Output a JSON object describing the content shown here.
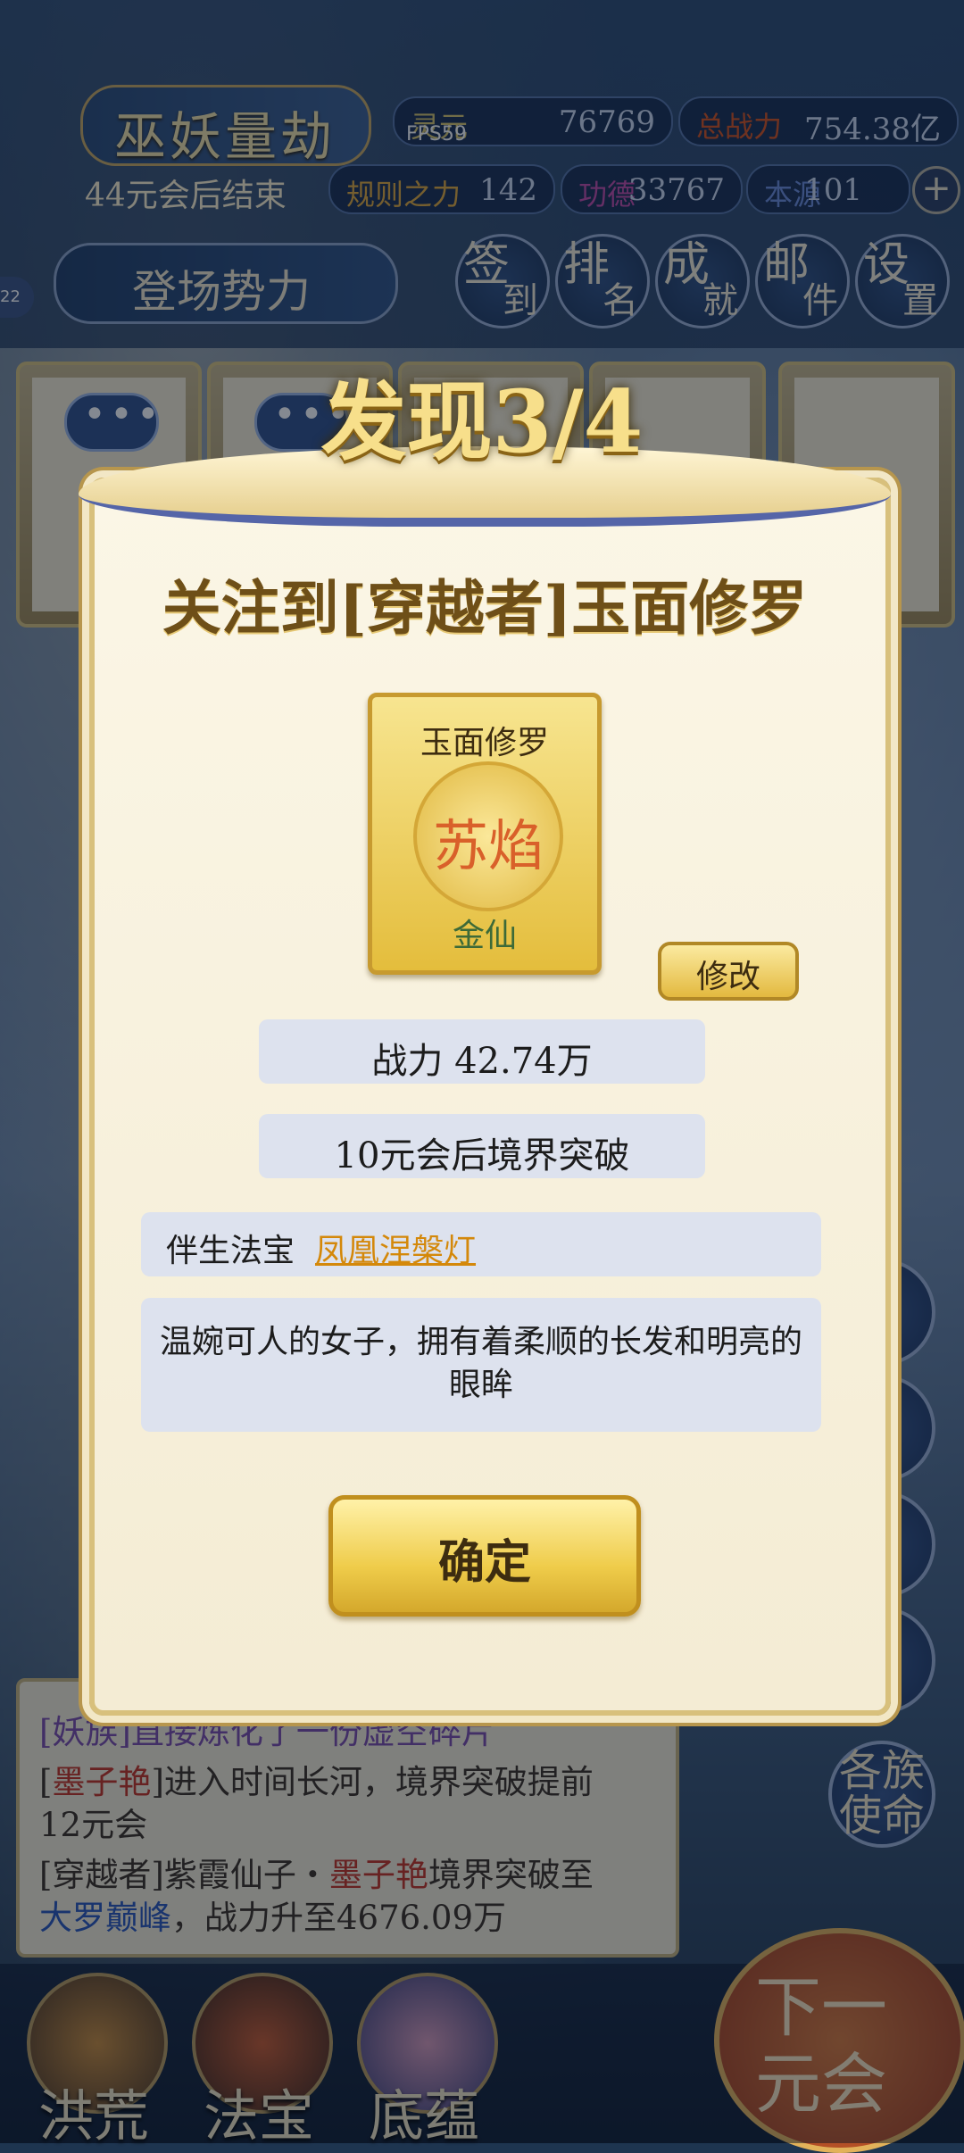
{
  "header": {
    "game_title": "巫妖量劫",
    "end_text": "44元会后结束",
    "fps": "FPS59",
    "stats": [
      {
        "label": "灵元",
        "value": "76769",
        "label_color": "#d7c46a"
      },
      {
        "label": "总战力",
        "value": "754.38亿",
        "label_color": "#d4501c"
      },
      {
        "label": "规则之力",
        "value": "142",
        "label_color": "#e0a83a"
      },
      {
        "label": "功德",
        "value": "33767",
        "label_color": "#c04aa6"
      },
      {
        "label": "本源",
        "value": "101",
        "label_color": "#6b8ad8"
      }
    ],
    "plus": "+",
    "faction_bar": "登场势力",
    "level_badge": "22",
    "quick_buttons": [
      {
        "a": "签",
        "b": "到"
      },
      {
        "a": "排",
        "b": "名"
      },
      {
        "a": "成",
        "b": "就"
      },
      {
        "a": "邮",
        "b": "件"
      },
      {
        "a": "设",
        "b": "置"
      }
    ]
  },
  "modal": {
    "discover": "发现3/4",
    "notice": "关注到[穿越者]玉面修罗",
    "card": {
      "title": "玉面修罗",
      "name": "苏焰",
      "rank": "金仙"
    },
    "edit": "修改",
    "power": "战力 42.74万",
    "breakthrough": "10元会后境界突破",
    "treasure_label": "伴生法宝",
    "treasure_name": "凤凰涅槃灯",
    "description": "温婉可人的女子，拥有着柔顺的长发和明亮的眼眸",
    "confirm": "确定"
  },
  "log": {
    "line1_tag": "[妖族]",
    "line1_text": "直接炼化了一份虚空碎片",
    "line2_open": "[",
    "line2_name": "墨子艳",
    "line2_close": "]进入时间长河，境界突破提前",
    "line2b": "12元会",
    "line3_a": "[穿越者]紫霞仙子・",
    "line3_name": "墨子艳",
    "line3_b": "境界突破至",
    "line4_realm": "大罗巅峰",
    "line4_text": "，战力升至4676.09万"
  },
  "side": {
    "mission_a": "各族",
    "mission_b": "使命"
  },
  "bottom_nav": {
    "items": [
      "洪荒",
      "法宝",
      "底蕴"
    ],
    "next_a": "下一",
    "next_b": "元会"
  }
}
